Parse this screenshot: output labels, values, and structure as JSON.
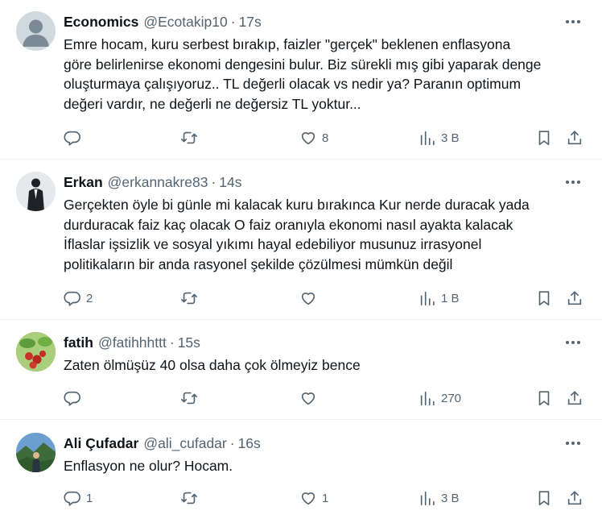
{
  "tweets": [
    {
      "name": "Economics",
      "handle": "@Ecotakip10",
      "sep": "·",
      "time": "17s",
      "lines": [
        "Emre hocam, kuru serbest bırakıp, faizler \"gerçek\" beklenen enflasyona",
        "göre belirlenirse ekonomi dengesini bulur. Biz sürekli mış gibi yaparak denge",
        "oluşturmaya çalışıyoruz.. TL değerli olacak vs nedir ya? Paranın optimum",
        "değeri vardır, ne değerli ne değersiz TL yoktur..."
      ],
      "replies": "",
      "likes": "8",
      "views": "3 B"
    },
    {
      "name": "Erkan",
      "handle": "@erkannakre83",
      "sep": "·",
      "time": "14s",
      "lines": [
        "Gerçekten öyle bi günle mi kalacak kuru bırakınca Kur nerde duracak yada",
        "durduracak faiz kaç olacak O faiz oranıyla ekonomi nasıl ayakta kalacak",
        "İflaslar işsizlik ve sosyal yıkımı hayal edebiliyor musunuz irrasyonel",
        "politikaların bir anda rasyonel şekilde çözülmesi mümkün değil"
      ],
      "replies": "2",
      "likes": "",
      "views": "1 B"
    },
    {
      "name": "fatih",
      "handle": "@fatihhhttt",
      "sep": "·",
      "time": "15s",
      "lines": [
        "Zaten ölmüşüz 40 olsa daha çok ölmeyiz  bence"
      ],
      "replies": "",
      "likes": "",
      "views": "270"
    },
    {
      "name": "Ali Çufadar",
      "handle": "@ali_cufadar",
      "sep": "·",
      "time": "16s",
      "lines": [
        "Enflasyon ne olur? Hocam."
      ],
      "replies": "1",
      "likes": "1",
      "views": "3 B"
    }
  ],
  "icons": {
    "reply": "reply-icon",
    "retweet": "retweet-icon",
    "like": "like-icon",
    "views": "views-icon",
    "bookmark": "bookmark-icon",
    "share": "share-icon",
    "more": "more-icon"
  },
  "colors": {
    "text": "#0f1419",
    "secondary": "#536471",
    "divider": "#eff3f4"
  }
}
